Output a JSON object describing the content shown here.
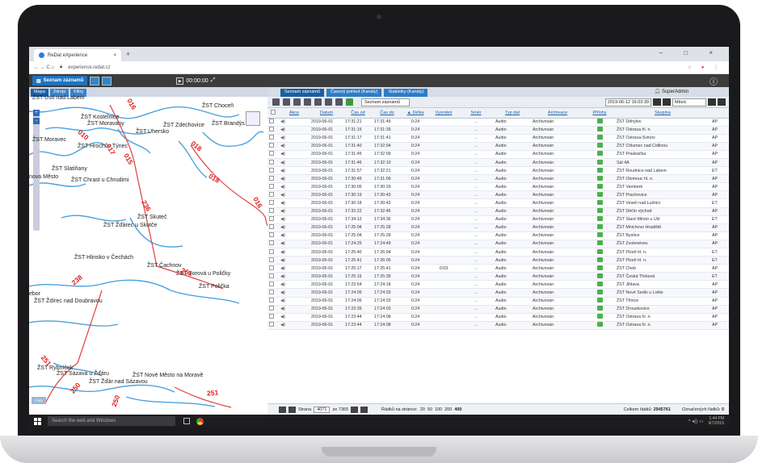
{
  "browser": {
    "tab_title": "ReDat eXperience",
    "tab_close": "×",
    "new_tab": "+",
    "window_controls": "– □ ×",
    "nav": "← → C ⌂",
    "url": "experience.redat.cz"
  },
  "app": {
    "list_button": "Seznam záznamů",
    "timer": "00:00:00",
    "info_icon": "ⓘ"
  },
  "left_tabs": [
    "Mapa",
    "Zdroje",
    "Filtry"
  ],
  "map": {
    "zoom_in": "+",
    "zoom_out": "−",
    "badge": "1 km",
    "labels": [
      "ŽST Ústí nad Labem",
      "ŽST Choceň",
      "ŽST Kostelnice",
      "ŽST Moravany",
      "ŽST Uhersko",
      "ŽST Zdechovice",
      "ŽST Brandýs",
      "ŽST Moravec",
      "ŽST Hrochův Týnec",
      "ŽST Slatiňany",
      "ŽST Chrast u Chrudimi",
      "ŽST Skuteč",
      "ŽST Žďárec u Skutče",
      "ŽST Hlinsko v Čechách",
      "ŽST Čachnov",
      "ŽST Borová u Poličky",
      "ŽST Polička",
      "ŽST Ždírec nad Doubravou",
      "ŽST Sázava u Žďáru",
      "ŽST Nové Město na Moravě",
      "ŽST Žďár nad Sázavou",
      "ŽST Rybníček",
      "nova Město",
      "ebor"
    ],
    "route_numbers": [
      "016",
      "017",
      "018",
      "015",
      "010",
      "016",
      "018",
      "236",
      "261",
      "238",
      "250",
      "251",
      "250",
      "251"
    ]
  },
  "right_tabs": [
    "Seznam záznamů",
    "Časový pohled (Kanály)",
    "Statistiky (Kanály)"
  ],
  "user": "SuperAdmin",
  "toolbar": {
    "view_select": "Seznam záznamů",
    "date": "2019-06-12 16:03:39",
    "period": "Měsíc"
  },
  "columns": [
    "",
    "Akce",
    "Datum",
    "Čas od",
    "Čas do",
    "▲ Délka",
    "Vyvolání",
    "Směr",
    "Typ dat",
    "Archivace",
    "Přílohy",
    "Skupina",
    ""
  ],
  "rows": [
    [
      "2019-06-01",
      "17:31:21",
      "17:31:45",
      "0:24",
      "",
      "→",
      "Audio",
      "Archivován",
      "ŽST Děhylov",
      "AP"
    ],
    [
      "2019-06-01",
      "17:31:15",
      "17:31:39",
      "0:24",
      "",
      "←",
      "Audio",
      "Archivován",
      "ŽST Ostrava hl. n.",
      "AP"
    ],
    [
      "2019-06-01",
      "17:31:17",
      "17:31:41",
      "0:24",
      "",
      "←",
      "Audio",
      "Archivován",
      "ŽST Ostrava-Svinov",
      "AP"
    ],
    [
      "2019-06-01",
      "17:31:40",
      "17:32:04",
      "0:24",
      "",
      "→",
      "Audio",
      "Archivován",
      "ŽST Chlumec nad Cidlinou",
      "AP"
    ],
    [
      "2019-06-01",
      "17:31:45",
      "17:32:09",
      "0:24",
      "",
      "→",
      "Audio",
      "Archivován",
      "ŽST Praskačka",
      "AP"
    ],
    [
      "2019-06-01",
      "17:31:46",
      "17:32:10",
      "0:24",
      "",
      "←",
      "Audio",
      "Archivován",
      "Sál 4A",
      "AP"
    ],
    [
      "2019-06-01",
      "17:31:57",
      "17:32:21",
      "0:24",
      "",
      "→",
      "Audio",
      "Archivován",
      "ŽST Roudnice nad Labem",
      "ET"
    ],
    [
      "2019-06-01",
      "17:30:45",
      "17:31:09",
      "0:24",
      "",
      "→",
      "Audio",
      "Archivován",
      "ŽST Olomouc hl. n.",
      "AP"
    ],
    [
      "2019-06-01",
      "17:30:05",
      "17:30:29",
      "0:24",
      "",
      "→",
      "Audio",
      "Archivován",
      "ŽST Vamberk",
      "AP"
    ],
    [
      "2019-06-01",
      "17:30:19",
      "17:30:43",
      "0:24",
      "",
      "→",
      "Audio",
      "Archivován",
      "ŽST Prachovice",
      "AP"
    ],
    [
      "2019-06-01",
      "17:30:18",
      "17:30:42",
      "0:24",
      "",
      "←",
      "Audio",
      "Archivován",
      "ŽST Veselí nad Lužnicí",
      "ET"
    ],
    [
      "2019-06-01",
      "17:32:22",
      "17:32:46",
      "0:24",
      "",
      "→",
      "Audio",
      "Archivován",
      "ŽST Děčín východ",
      "AP"
    ],
    [
      "2019-06-01",
      "17:34:12",
      "17:34:36",
      "0:24",
      "",
      "→",
      "Audio",
      "Archivován",
      "ŽST Staré Město u UH",
      "ET"
    ],
    [
      "2019-06-01",
      "17:25:04",
      "17:25:28",
      "0:24",
      "",
      "→",
      "Audio",
      "Archivován",
      "ŽST Mnichovo Hradiště",
      "AP"
    ],
    [
      "2019-06-01",
      "17:25:04",
      "17:25:28",
      "0:24",
      "",
      "→",
      "Audio",
      "Archivován",
      "ŽST Bystice",
      "AP"
    ],
    [
      "2019-06-01",
      "17:24:25",
      "17:24:49",
      "0:24",
      "",
      "→",
      "Audio",
      "Archivován",
      "ŽST Zvolenëves",
      "AP"
    ],
    [
      "2019-06-01",
      "17:25:40",
      "17:26:04",
      "0:24",
      "",
      "←",
      "Audio",
      "Archivován",
      "ŽST Plzeň hl. n.",
      "ET"
    ],
    [
      "2019-06-01",
      "17:25:41",
      "17:26:05",
      "0:24",
      "",
      "←",
      "Audio",
      "Archivován",
      "ŽST Plzeň hl. n.",
      "ET"
    ],
    [
      "2019-06-01",
      "17:25:17",
      "17:25:41",
      "0:24",
      "0:03",
      "←",
      "Audio",
      "Archivován",
      "ŽST Cheb",
      "AP"
    ],
    [
      "2019-06-01",
      "17:25:15",
      "17:25:39",
      "0:24",
      "",
      "→",
      "Audio",
      "Archivován",
      "ŽST Česká Třebová",
      "ET"
    ],
    [
      "2019-06-01",
      "17:23:54",
      "17:24:18",
      "0:24",
      "",
      "→",
      "Audio",
      "Archivován",
      "ŽST Jihlava",
      "AP"
    ],
    [
      "2019-06-01",
      "17:24:09",
      "17:24:33",
      "0:24",
      "",
      "→",
      "Audio",
      "Archivován",
      "ŽST Nové Sedlo u Lokte",
      "AP"
    ],
    [
      "2019-06-01",
      "17:24:09",
      "17:24:33",
      "0:24",
      "",
      "→",
      "Audio",
      "Archivován",
      "ŽST Třinice",
      "AP"
    ],
    [
      "2019-06-01",
      "17:23:39",
      "17:24:03",
      "0:24",
      "",
      "→",
      "Audio",
      "Archivován",
      "ŽST Drouzkovice",
      "AP"
    ],
    [
      "2019-06-01",
      "17:23:44",
      "17:24:08",
      "0:24",
      "",
      "→",
      "Audio",
      "Archivován",
      "ŽST Ostrava hl. n.",
      "AP"
    ],
    [
      "2019-06-01",
      "17:23:44",
      "17:24:08",
      "0:24",
      "",
      "→",
      "Audio",
      "Archivován",
      "ŽST Ostrava hl. n.",
      "AP"
    ]
  ],
  "pager": {
    "page_label": "Strana",
    "page": "4071",
    "of_label": "ze 7365",
    "rows_label": "Řádků na stránce:",
    "rows_options": [
      "20",
      "50",
      "100",
      "200",
      "400"
    ],
    "total_label": "Celkem řádků:",
    "total": "2945761",
    "selected_label": "Označených řádků:",
    "selected": "0"
  },
  "taskbar": {
    "search": "Search the web and Windows",
    "time": "1:44 PM",
    "date": "9/7/2015"
  },
  "colors": {
    "accent": "#1e73be",
    "route": "#e02020",
    "river": "#4aa3df"
  }
}
